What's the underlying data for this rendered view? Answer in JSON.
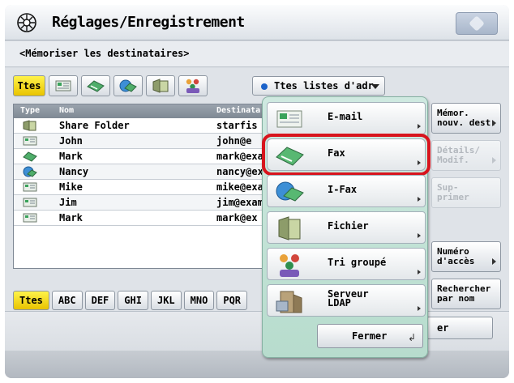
{
  "header": {
    "title": "Réglages/Enregistrement"
  },
  "subheader": {
    "label": "<Mémoriser les destinataires>"
  },
  "type_filter": {
    "all_label": "Ttes",
    "selected": "Ttes"
  },
  "address_list": {
    "selected": "Ttes listes d'adr"
  },
  "table": {
    "columns": [
      "Type",
      "Nom",
      "Destinata"
    ],
    "rows": [
      {
        "type_icon": "folder-icon",
        "name": "Share Folder",
        "destination": "starfis"
      },
      {
        "type_icon": "email-icon",
        "name": "John",
        "destination": "john@e"
      },
      {
        "type_icon": "fax-icon",
        "name": "Mark",
        "destination": "mark@exa"
      },
      {
        "type_icon": "ifax-icon",
        "name": "Nancy",
        "destination": "nancy@ex"
      },
      {
        "type_icon": "email-icon",
        "name": "Mike",
        "destination": "mike@exa"
      },
      {
        "type_icon": "email-icon",
        "name": "Jim",
        "destination": "jim@exam"
      },
      {
        "type_icon": "email-icon",
        "name": "Mark",
        "destination": "mark@ex"
      }
    ]
  },
  "alpha_filter": [
    "Ttes",
    "ABC",
    "DEF",
    "GHI",
    "JKL",
    "MNO",
    "PQR"
  ],
  "side_buttons": {
    "memorize": "Mémor.\nnouv. dest.",
    "details": "Détails/\nModif.",
    "delete": "Sup-\nprimer",
    "access_number": "Numéro\nd'accès",
    "search_name": "Rechercher\npar nom"
  },
  "bottom": {
    "partial_button": "er"
  },
  "popup": {
    "items": [
      {
        "label": "E-mail",
        "icon": "email-icon"
      },
      {
        "label": "Fax",
        "icon": "fax-icon"
      },
      {
        "label": "I-Fax",
        "icon": "ifax-icon"
      },
      {
        "label": "Fichier",
        "icon": "folder-icon"
      },
      {
        "label": "Tri groupé",
        "icon": "group-icon"
      },
      {
        "label": "Serveur\nLDAP",
        "icon": "ldap-server-icon"
      }
    ],
    "selected": "Fax",
    "close_label": "Fermer"
  },
  "colors": {
    "highlight": "#d8141d",
    "active_yellow": "#f5d400",
    "popup_bg": "#c3e2d6"
  }
}
